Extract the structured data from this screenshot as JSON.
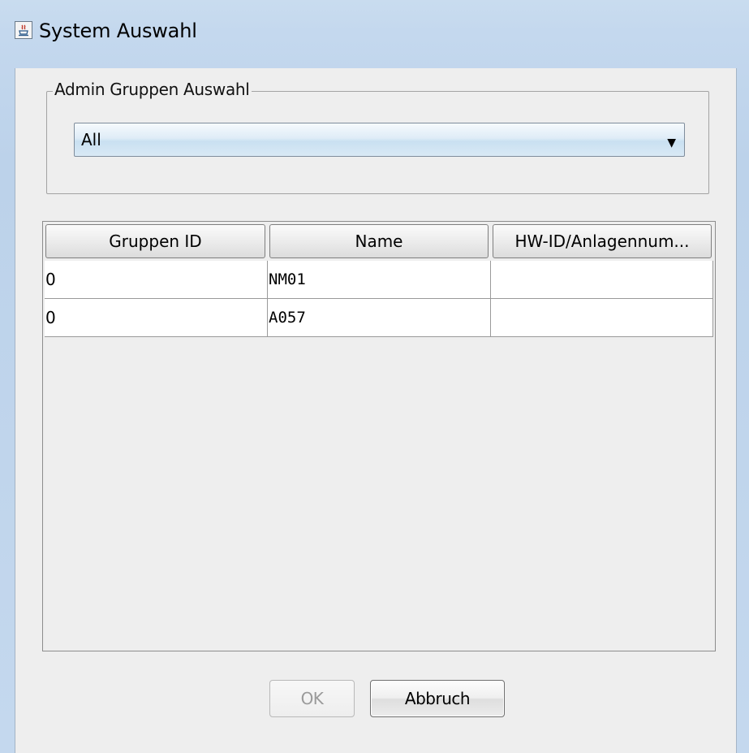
{
  "window": {
    "title": "System Auswahl",
    "icon": "java-app-icon"
  },
  "group_selection": {
    "legend": "Admin Gruppen Auswahl",
    "combo_value": "All",
    "arrow_icon": "chevron-down-icon"
  },
  "table": {
    "columns": [
      "Gruppen ID",
      "Name",
      "HW-ID/Anlagennum..."
    ],
    "rows": [
      [
        "0",
        "NM01",
        ""
      ],
      [
        "0",
        "A057",
        ""
      ]
    ]
  },
  "buttons": {
    "ok_label": "OK",
    "cancel_label": "Abbruch"
  },
  "colors": {
    "window_frame": "#c4d8ee",
    "panel_background": "#eeeeee",
    "disabled_text": "#9a9a9a"
  }
}
